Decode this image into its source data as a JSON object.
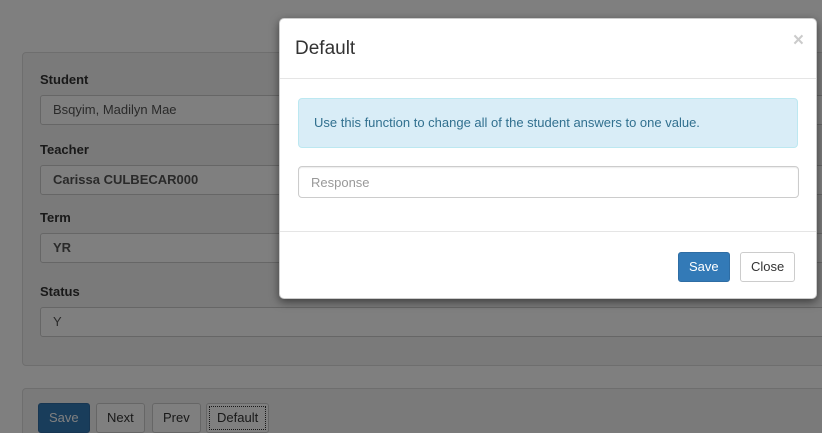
{
  "form": {
    "student_label": "Student",
    "student_value": "Bsqyim, Madilyn Mae",
    "teacher_label": "Teacher",
    "teacher_value": "Carissa CULBECAR000",
    "term_label": "Term",
    "term_value": "YR",
    "status_label": "Status",
    "status_value": "Y"
  },
  "buttons": {
    "save": "Save",
    "next": "Next",
    "prev": "Prev",
    "default": "Default"
  },
  "modal": {
    "title": "Default",
    "close_glyph": "×",
    "info_text": "Use this function to change all of the student answers to one value.",
    "response_placeholder": "Response",
    "response_value": "",
    "save_label": "Save",
    "close_label": "Close"
  },
  "colors": {
    "primary": "#337ab7",
    "info_bg": "#d9edf7",
    "info_text": "#31708f"
  }
}
